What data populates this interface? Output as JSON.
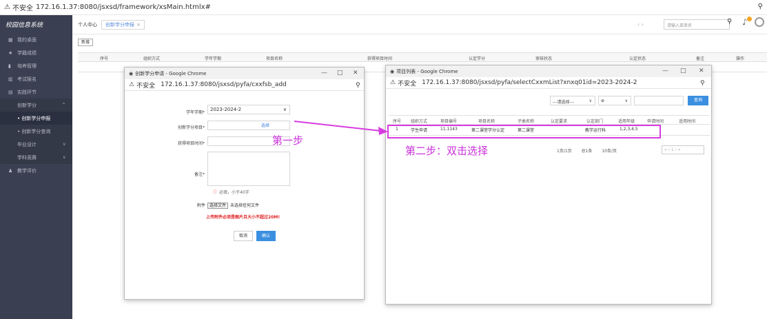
{
  "browser": {
    "warning": "不安全",
    "url": "172.16.1.37:8080/jsxsd/framework/xsMain.htmlx#"
  },
  "sidebar": {
    "logo": "校园信息系统",
    "items": [
      {
        "icon": "grid-icon",
        "label": "我的桌面"
      },
      {
        "icon": "star-icon",
        "label": "学籍成绩"
      },
      {
        "icon": "book-icon",
        "label": "培养管理"
      },
      {
        "icon": "chart-icon",
        "label": "考试报名"
      },
      {
        "icon": "folder-icon",
        "label": "实践环节"
      }
    ],
    "subitems": [
      {
        "label": "创新学分",
        "arrow": "^"
      },
      {
        "label": "• 创新学分申报",
        "active": true
      },
      {
        "label": "• 创新学分查询"
      },
      {
        "label": "毕业设计",
        "arrow": "v"
      },
      {
        "label": "学科竞赛",
        "arrow": "v"
      }
    ],
    "last": {
      "icon": "user-icon",
      "label": "教学评价"
    }
  },
  "topbar": {
    "home": "个人中心",
    "tab": "创新学分申报",
    "tab_close": "×",
    "nav": "‹  ›",
    "search_placeholder": "请输入菜单名"
  },
  "content": {
    "add_button": "新增",
    "columns": [
      "序号",
      "组织方式",
      "学年学期",
      "项目名称",
      "获得项目时间",
      "认定学分",
      "审核状态",
      "认定状态",
      "备注",
      "操作"
    ]
  },
  "dialog1": {
    "title": "创新学分申请 - Google Chrome",
    "url": "172.16.1.37:8080/jsxsd/pyfa/cxxfsb_add",
    "term_label": "学年学期*",
    "term_value": "2023-2024-2",
    "project_label": "创新学分项目*",
    "select_link": "选择",
    "time_label": "获得项目时间*",
    "remark_label": "备注*",
    "hint": "必填，小于40字",
    "attach_label": "附件",
    "file_button": "选择文件",
    "no_file": "未选择任何文件",
    "upload_warning": "上传附件必须是图片且大小不超过20M!",
    "cancel": "取消",
    "confirm": "确认",
    "step1": "第一步"
  },
  "dialog2": {
    "title": "项目列表 - Google Chrome",
    "url": "172.16.1.37:8080/jsxsd/pyfa/selectCxxmList?xnxq01id=2023-2024-2",
    "filter1": "---请选择---",
    "filter2": "⊕",
    "query": "查询",
    "columns": [
      "序号",
      "组织方式",
      "项目编号",
      "项目名称",
      "子类名称",
      "认定要求",
      "认定部门",
      "适用年级",
      "申请时间",
      "适用时间"
    ],
    "row": [
      "1",
      "学生申请",
      "11.1143",
      "第二课堂学分认定",
      "第二课堂",
      "",
      "教学运行科",
      "1,2,3,4,5",
      "",
      ""
    ],
    "step2": "第二步：双击选择",
    "pager_info": [
      "1页/1页",
      "总1条",
      "10条/页"
    ],
    "pager_nav": "« ‹ 1 › »"
  },
  "colors": {
    "accent": "#3b8fe0",
    "highlight": "#d83be0",
    "sidebar": "#3a3f51"
  }
}
